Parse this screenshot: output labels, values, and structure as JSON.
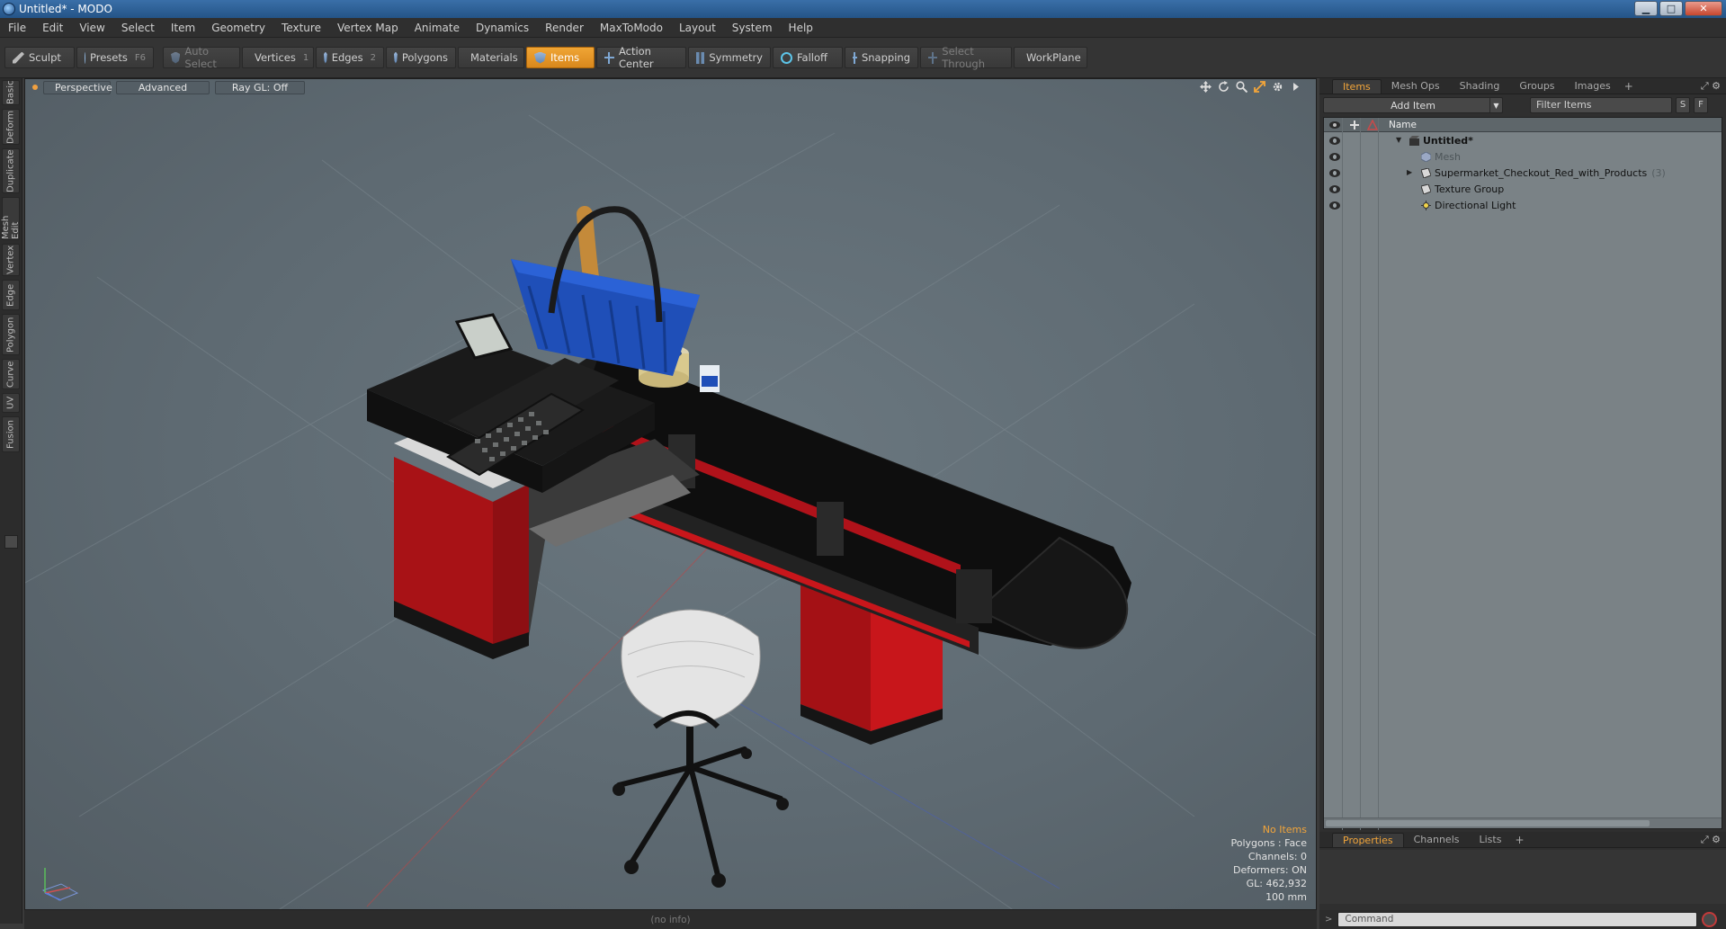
{
  "window": {
    "title": "Untitled* - MODO"
  },
  "menu": [
    "File",
    "Edit",
    "View",
    "Select",
    "Item",
    "Geometry",
    "Texture",
    "Vertex Map",
    "Animate",
    "Dynamics",
    "Render",
    "MaxToModo",
    "Layout",
    "System",
    "Help"
  ],
  "toolbar": {
    "sculpt": "Sculpt",
    "presets": "Presets",
    "presets_key": "F6",
    "auto_select": "Auto Select",
    "vertices": "Vertices",
    "vertices_key": "1",
    "edges": "Edges",
    "edges_key": "2",
    "polygons": "Polygons",
    "materials": "Materials",
    "items": "Items",
    "action_center": "Action Center",
    "symmetry": "Symmetry",
    "falloff": "Falloff",
    "snapping": "Snapping",
    "select_through": "Select Through",
    "workplane": "WorkPlane"
  },
  "left_tabs": [
    "Basic",
    "Deform",
    "Duplicate",
    "Mesh Edit",
    "Vertex",
    "Edge",
    "Polygon",
    "Curve",
    "UV",
    "Fusion"
  ],
  "viewport": {
    "view": "Perspective",
    "shading": "Advanced",
    "raygl": "Ray GL: Off",
    "info": {
      "items": "No Items",
      "polygons": "Polygons : Face",
      "channels": "Channels: 0",
      "deformers": "Deformers: ON",
      "gl": "GL: 462,932",
      "scale": "100 mm"
    }
  },
  "items_panel": {
    "tabs": [
      "Items",
      "Mesh Ops",
      "Shading",
      "Groups",
      "Images"
    ],
    "add_item": "Add Item",
    "filter_placeholder": "Filter Items",
    "btn_s": "S",
    "btn_f": "F",
    "column_name": "Name",
    "rows": [
      {
        "label": "Untitled*",
        "type": "scene"
      },
      {
        "label": "Mesh",
        "type": "mesh"
      },
      {
        "label": "Supermarket_Checkout_Red_with_Products",
        "count": "(3)",
        "type": "group"
      },
      {
        "label": "Texture Group",
        "type": "group"
      },
      {
        "label": "Directional Light",
        "type": "light"
      }
    ]
  },
  "properties_panel": {
    "tabs": [
      "Properties",
      "Channels",
      "Lists"
    ]
  },
  "status": {
    "info": "(no info)"
  },
  "command": {
    "placeholder": "Command"
  },
  "colors": {
    "accent": "#f2a53a",
    "viewport_bg": "#5e6a72",
    "checkout_red": "#c8161b",
    "basket_blue": "#1f4fb8"
  }
}
